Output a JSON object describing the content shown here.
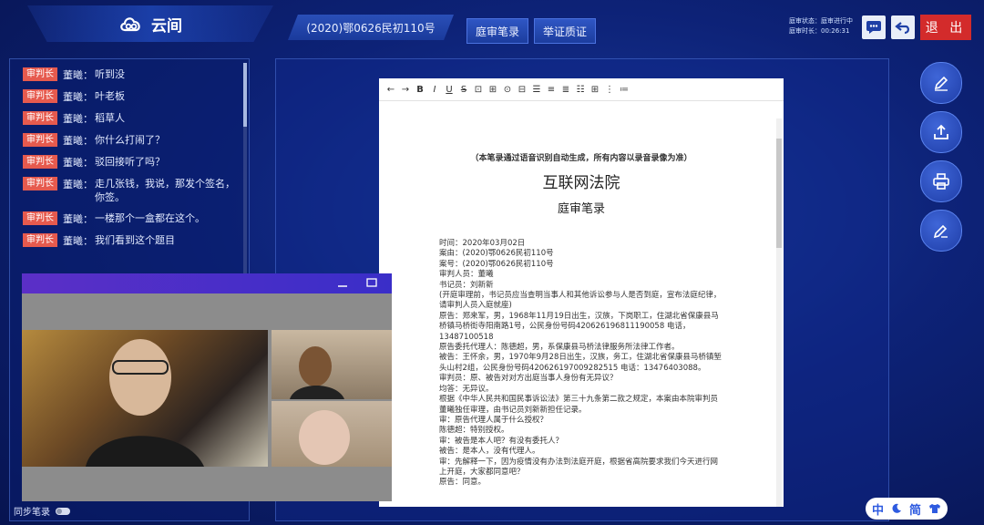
{
  "app": {
    "name": "云间"
  },
  "header": {
    "case_number": "(2020)鄂0626民初110号",
    "tabs": [
      {
        "label": "庭审笔录"
      },
      {
        "label": "举证质证"
      }
    ],
    "status_line1": "庭审状态：庭审进行中",
    "status_line2": "庭审时长：00:26:31",
    "exit_label": "退 出"
  },
  "chat": {
    "messages": [
      {
        "role": "审判长",
        "speaker": "董曦：",
        "text": "听到没"
      },
      {
        "role": "审判长",
        "speaker": "董曦：",
        "text": "叶老板"
      },
      {
        "role": "审判长",
        "speaker": "董曦：",
        "text": "稻草人"
      },
      {
        "role": "审判长",
        "speaker": "董曦：",
        "text": "你什么打闹了？"
      },
      {
        "role": "审判长",
        "speaker": "董曦：",
        "text": "驳回接听了吗？"
      },
      {
        "role": "审判长",
        "speaker": "董曦：",
        "text": "走几张钱，我说，那发个签名，你签。"
      },
      {
        "role": "审判长",
        "speaker": "董曦：",
        "text": "一楼那个一盒都在这个。"
      },
      {
        "role": "审判长",
        "speaker": "董曦：",
        "text": "我们看到这个题目"
      }
    ],
    "sync_label": "同步笔录"
  },
  "document": {
    "toolbar": [
      "←",
      "→",
      "B",
      "I",
      "U",
      "S",
      "⊡",
      "⊞",
      "⊙",
      "⊟",
      "☰",
      "≡",
      "≣",
      "☷",
      "⊞",
      "⋮",
      "≔"
    ],
    "note": "（本笔录通过语音识别自动生成，所有内容以录音录像为准）",
    "court": "互联网法院",
    "heading": "庭审笔录",
    "lines": [
      "时间：2020年03月02日",
      "案由：(2020)鄂0626民初110号",
      "案号：(2020)鄂0626民初110号",
      "审判人员：董曦",
      "书记员：刘新新",
      "(开庭审理前，书记员应当查明当事人和其他诉讼参与人是否到庭，宣布法庭纪律，请审判人员入庭就座)",
      "原告：郑来军，男，1968年11月19日出生，汉族，下岗职工，住湖北省保康县马桥镇马桥街寺阳南路1号，公民身份号码420626196811190058 电话，13487100518",
      "原告委托代理人：陈德超，男，系保康县马桥法律服务所法律工作者。",
      "被告：王怀余，男，1970年9月28日出生，汉族，务工，住湖北省保康县马桥镇堑头山村2组，公民身份号码420626197009282515 电话：13476403088。",
      "审判员：原、被告对对方出庭当事人身份有无异议？",
      "均答：无异议。",
      "根据《中华人民共和国民事诉讼法》第三十九条第二款之规定，本案由本院审判员董曦独任审理，由书记员刘新新担任记录。",
      "审：原告代理人属于什么授权？",
      "陈德超：特别授权。",
      "审：被告是本人吧？有没有委托人？",
      "被告：是本人，没有代理人。",
      "审：先解释一下，因为疫情没有办法到法庭开庭，根据省高院要求我们今天进行网上开庭，大家都同意吧？",
      "原告：同意。"
    ]
  },
  "side_buttons": [
    "pen-icon",
    "upload-icon",
    "printer-icon",
    "sign-icon"
  ],
  "lang_switch": {
    "first": "中",
    "second": "简"
  },
  "colors": {
    "badge": "#e65a4e",
    "exit": "#d32b2b",
    "accent": "#2e5be0"
  }
}
